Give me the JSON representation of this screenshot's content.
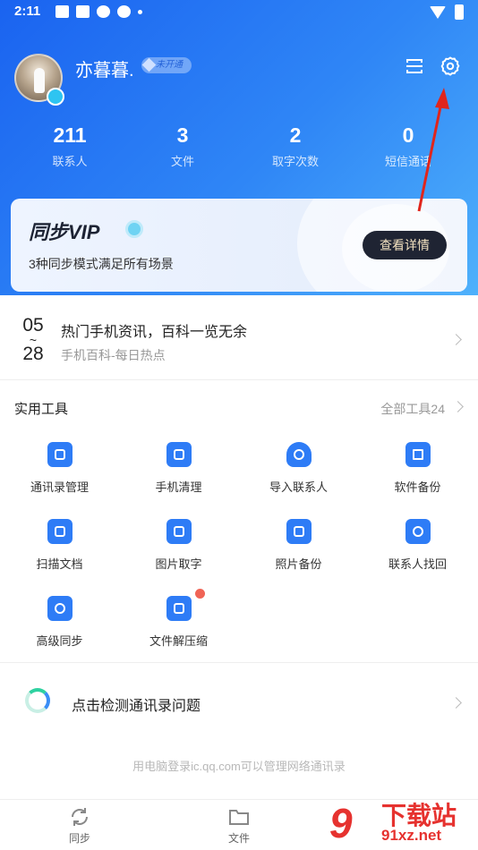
{
  "status_bar": {
    "time": "2:11"
  },
  "profile": {
    "username": "亦暮暮.",
    "vip_status": "未开通"
  },
  "stats": [
    {
      "value": "211",
      "label": "联系人"
    },
    {
      "value": "3",
      "label": "文件"
    },
    {
      "value": "2",
      "label": "取字次数"
    },
    {
      "value": "0",
      "label": "短信通话"
    }
  ],
  "vip_card": {
    "title": "同步VIP",
    "subtitle": "3种同步模式满足所有场景",
    "button_label": "查看详情"
  },
  "news": {
    "month": "05",
    "day": "28",
    "title": "热门手机资讯，百科一览无余",
    "subtitle": "手机百科-每日热点"
  },
  "tools": {
    "title": "实用工具",
    "all_label": "全部工具24",
    "items": [
      {
        "label": "通讯录管理",
        "icon": "contact-book-icon",
        "color": "#2e7cf6"
      },
      {
        "label": "手机清理",
        "icon": "phone-clean-icon",
        "color": "#2e7cf6"
      },
      {
        "label": "导入联系人",
        "icon": "import-contact-icon",
        "color": "#2e7cf6"
      },
      {
        "label": "软件备份",
        "icon": "app-backup-icon",
        "color": "#2e7cf6"
      },
      {
        "label": "扫描文档",
        "icon": "scan-document-icon",
        "color": "#2e7cf6"
      },
      {
        "label": "图片取字",
        "icon": "image-text-icon",
        "color": "#2e7cf6"
      },
      {
        "label": "照片备份",
        "icon": "photo-backup-icon",
        "color": "#2e7cf6"
      },
      {
        "label": "联系人找回",
        "icon": "contact-recover-icon",
        "color": "#2e7cf6"
      },
      {
        "label": "高级同步",
        "icon": "advanced-sync-icon",
        "color": "#2e7cf6"
      },
      {
        "label": "文件解压缩",
        "icon": "file-unzip-icon",
        "color": "#2e7cf6"
      }
    ]
  },
  "detect": {
    "label": "点击检测通讯录问题"
  },
  "footer_note": "用电脑登录ic.qq.com可以管理网络通讯录",
  "tabbar": [
    {
      "label": "同步",
      "icon": "sync-icon"
    },
    {
      "label": "文件",
      "icon": "folder-icon"
    }
  ],
  "watermark": {
    "brand": "下载站",
    "url": "91xz.net"
  }
}
